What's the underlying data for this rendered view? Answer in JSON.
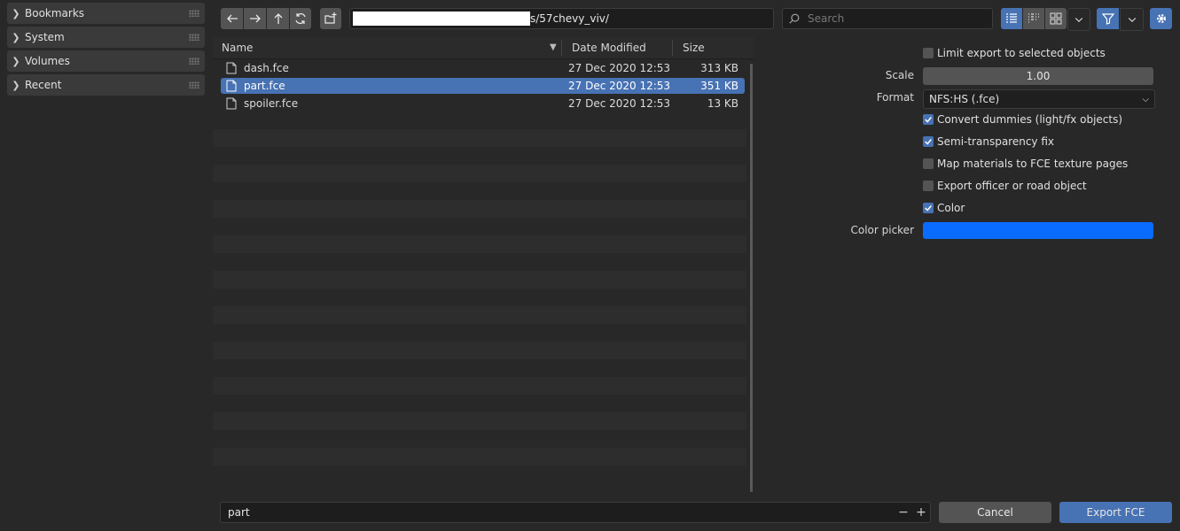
{
  "sidebar": {
    "panels": [
      {
        "label": "Bookmarks"
      },
      {
        "label": "System"
      },
      {
        "label": "Volumes"
      },
      {
        "label": "Recent"
      }
    ]
  },
  "toolbar": {
    "path_suffix": "s/57chevy_viv/",
    "search_placeholder": "Search"
  },
  "file_list": {
    "columns": {
      "name": "Name",
      "date": "Date Modified",
      "size": "Size"
    },
    "rows": [
      {
        "name": "dash.fce",
        "date": "27 Dec 2020 12:53",
        "size": "313 KB",
        "selected": false
      },
      {
        "name": "part.fce",
        "date": "27 Dec 2020 12:53",
        "size": "351 KB",
        "selected": true
      },
      {
        "name": "spoiler.fce",
        "date": "27 Dec 2020 12:53",
        "size": "13 KB",
        "selected": false
      }
    ]
  },
  "props": {
    "limit_export": {
      "label": "Limit export to selected objects",
      "checked": false
    },
    "scale": {
      "label": "Scale",
      "value": "1.00"
    },
    "format": {
      "label": "Format",
      "value": "NFS:HS (.fce)"
    },
    "convert_dummies": {
      "label": "Convert dummies (light/fx objects)",
      "checked": true
    },
    "semi_transparency": {
      "label": "Semi-transparency fix",
      "checked": true
    },
    "map_materials": {
      "label": "Map materials to FCE texture pages",
      "checked": false
    },
    "export_officer": {
      "label": "Export officer or road object",
      "checked": false
    },
    "color": {
      "label": "Color",
      "checked": true
    },
    "color_picker": {
      "label": "Color picker",
      "value": "#0a6cff"
    }
  },
  "footer": {
    "filename": "part",
    "cancel_label": "Cancel",
    "export_label": "Export FCE"
  },
  "colors": {
    "accent": "#4772b3"
  }
}
